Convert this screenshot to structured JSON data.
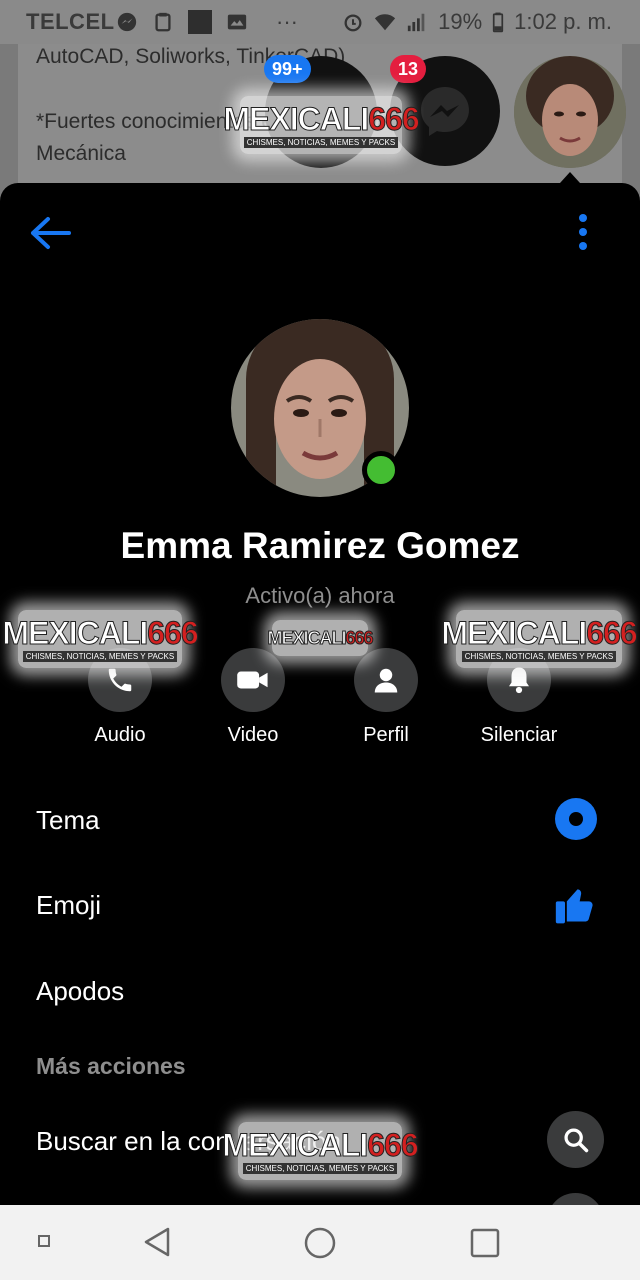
{
  "status_bar": {
    "carrier": "TELCEL",
    "dots": "···",
    "battery": "19%",
    "time": "1:02 p. m."
  },
  "background_app": {
    "line1": "AutoCAD, Soliworks, TinkerCAD)",
    "line2": "*Fuertes conocimientos en Simulación",
    "line3": "Mecánica"
  },
  "chat_heads": {
    "heads": [
      {
        "name": "video-app-chat-head",
        "badge": "99+",
        "badge_color": "#1877f2"
      },
      {
        "name": "messenger-chat-head",
        "badge": "13",
        "badge_color": "#e41e3f"
      },
      {
        "name": "contact-chat-head",
        "badge": ""
      }
    ]
  },
  "watermark": {
    "text_a": "MEXICALI",
    "text_b": "666",
    "tagline": "CHISMES, NOTICIAS, MEMES Y PACKS"
  },
  "profile": {
    "name": "Emma Ramirez Gomez",
    "status": "Activo(a) ahora",
    "online_color": "#44bd32"
  },
  "actions": [
    {
      "label": "Audio",
      "icon": "phone-icon"
    },
    {
      "label": "Video",
      "icon": "video-camera-icon"
    },
    {
      "label": "Perfil",
      "icon": "person-icon"
    },
    {
      "label": "Silenciar",
      "icon": "bell-icon"
    }
  ],
  "settings": {
    "theme": "Tema",
    "emoji": "Emoji",
    "nicknames": "Apodos",
    "more_actions_header": "Más acciones",
    "search": "Buscar en la conversación"
  },
  "colors": {
    "accent": "#1877f2",
    "panel_bg": "#000000",
    "muted_text": "#8e8e8e"
  }
}
